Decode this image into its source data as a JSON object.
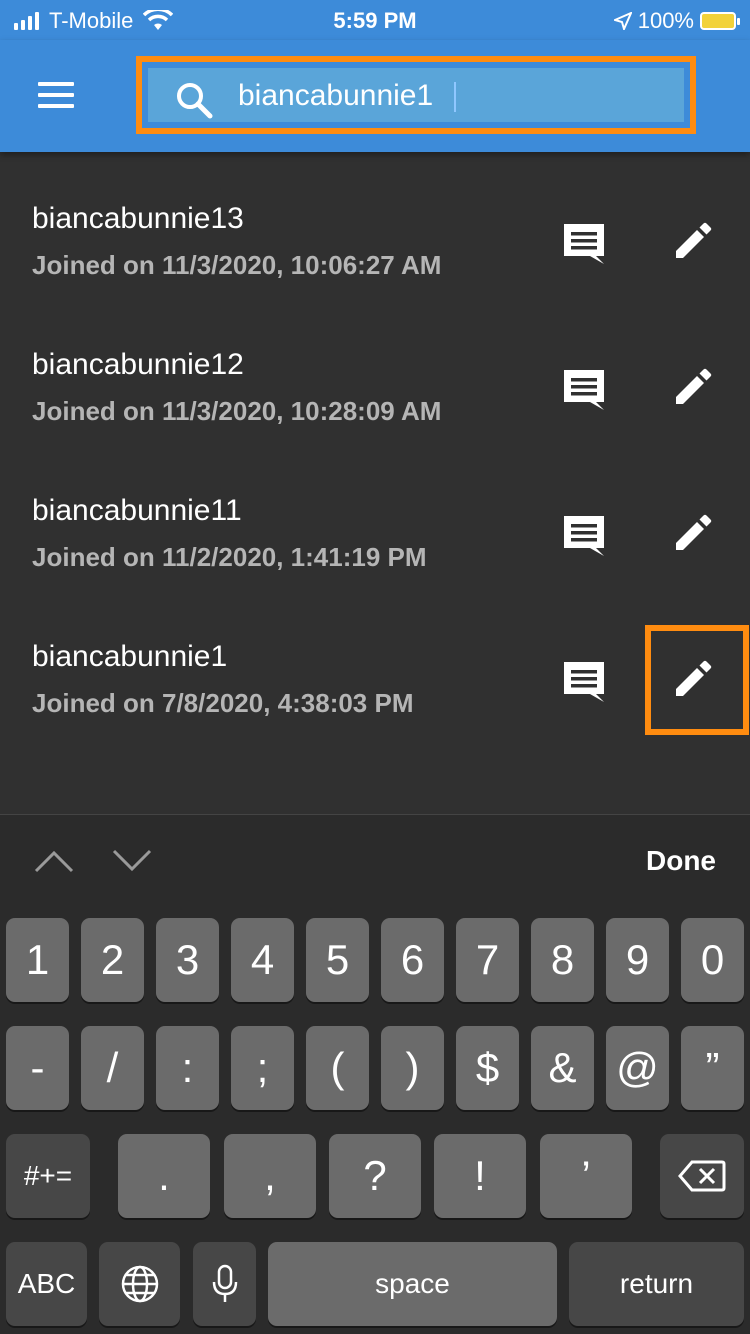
{
  "status": {
    "carrier": "T-Mobile",
    "time": "5:59 PM",
    "battery": "100%"
  },
  "search": {
    "value": "biancabunnie1",
    "icon": "search-icon"
  },
  "results": [
    {
      "name": "biancabunnie13",
      "joined": "Joined on 11/3/2020, 10:06:27 AM"
    },
    {
      "name": "biancabunnie12",
      "joined": "Joined on 11/3/2020, 10:28:09 AM"
    },
    {
      "name": "biancabunnie11",
      "joined": "Joined on 11/2/2020, 1:41:19 PM"
    },
    {
      "name": "biancabunnie1",
      "joined": "Joined on 7/8/2020, 4:38:03 PM"
    }
  ],
  "keyboard": {
    "done": "Done",
    "row1": [
      "1",
      "2",
      "3",
      "4",
      "5",
      "6",
      "7",
      "8",
      "9",
      "0"
    ],
    "row2": [
      "-",
      "/",
      ":",
      ";",
      "(",
      ")",
      "$",
      "&",
      "@",
      "”"
    ],
    "row3": [
      ".",
      ",",
      "?",
      "!",
      "’"
    ],
    "more": "#+=",
    "abc": "ABC",
    "space": "space",
    "return": "return"
  },
  "colors": {
    "appbar": "#3d8bd9",
    "highlight": "#ff8c10",
    "background": "#303030"
  }
}
